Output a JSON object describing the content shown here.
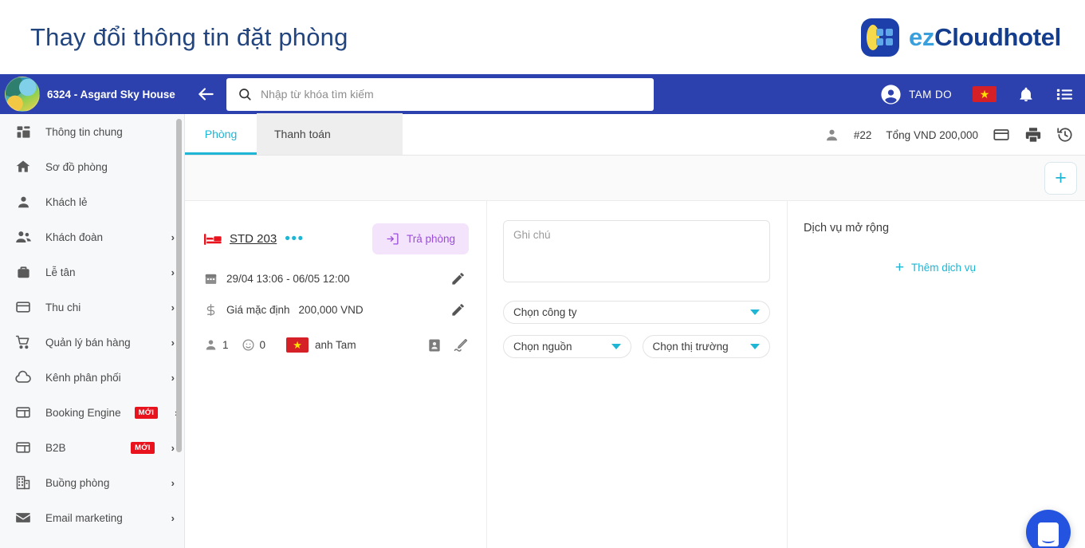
{
  "page": {
    "title": "Thay đổi thông tin đặt phòng"
  },
  "brand": {
    "prefix": "ez",
    "name": "Cloudhotel",
    "icon": "ezcloudhotel-logo-icon",
    "accent_light": "#3aa0dd",
    "accent_dark": "#143d8d"
  },
  "appbar": {
    "hotel": "6324 - Asgard Sky House",
    "hotel_avatar_icon": "hotel-avatar",
    "back_icon": "arrow-left-icon",
    "search": {
      "icon": "search-icon",
      "value": "",
      "placeholder": "Nhập từ khóa tìm kiếm"
    },
    "user": {
      "name": "TAM DO",
      "avatar_icon": "account-circle-icon"
    },
    "language_flag_icon": "vietnam-flag-icon",
    "notification_icon": "bell-icon",
    "menu_icon": "list-menu-icon",
    "background": "#2d41ae"
  },
  "sidebar": {
    "items": [
      {
        "label": "Thông tin chung",
        "icon": "dashboard-icon",
        "chevron": false,
        "badge": ""
      },
      {
        "label": "Sơ đồ phòng",
        "icon": "home-icon",
        "chevron": false,
        "badge": ""
      },
      {
        "label": "Khách lẻ",
        "icon": "person-icon",
        "chevron": false,
        "badge": ""
      },
      {
        "label": "Khách đoàn",
        "icon": "group-icon",
        "chevron": true,
        "badge": ""
      },
      {
        "label": "Lễ tân",
        "icon": "briefcase-icon",
        "chevron": true,
        "badge": ""
      },
      {
        "label": "Thu chi",
        "icon": "credit-card-icon",
        "chevron": true,
        "badge": ""
      },
      {
        "label": "Quản lý bán hàng",
        "icon": "shopping-cart-icon",
        "chevron": true,
        "badge": ""
      },
      {
        "label": "Kênh phân phối",
        "icon": "cloud-icon",
        "chevron": true,
        "badge": ""
      },
      {
        "label": "Booking Engine",
        "icon": "web-layout-icon",
        "chevron": true,
        "badge": "MỚI"
      },
      {
        "label": "B2B",
        "icon": "web-layout-icon",
        "chevron": true,
        "badge": "MỚI"
      },
      {
        "label": "Buồng phòng",
        "icon": "building-icon",
        "chevron": true,
        "badge": ""
      },
      {
        "label": "Email marketing",
        "icon": "envelope-icon",
        "chevron": true,
        "badge": ""
      }
    ],
    "badge_color": "#e8131d"
  },
  "tabs": [
    {
      "label": "Phòng",
      "active": true
    },
    {
      "label": "Thanh toán",
      "active": false
    }
  ],
  "toolbar": {
    "guest_icon": "person-icon",
    "booking_id": "#22",
    "total": "Tổng VND 200,000",
    "card_icon": "credit-card-icon",
    "print_icon": "printer-icon",
    "history_icon": "history-icon",
    "add_icon": "plus-icon",
    "accent": "#1eb6d4"
  },
  "room": {
    "bed_icon": "bed-icon",
    "name": "STD 203",
    "more_icon": "more-dots-icon",
    "checkout_label": "Trả phòng",
    "checkout_icon": "checkout-exit-icon",
    "date_icon": "calendar-icon",
    "dates": "29/04  13:06 - 06/05  12:00",
    "price_icon": "dollar-icon",
    "price_label": "Giá mặc định",
    "price_value": "200,000 VND",
    "adults_icon": "person-icon",
    "adults": "1",
    "children_icon": "child-face-icon",
    "children": "0",
    "guest_flag_icon": "vietnam-flag-icon",
    "guest_name": "anh Tam",
    "id_card_icon": "id-card-icon",
    "signature_icon": "signature-icon",
    "edit_icon": "pencil-icon"
  },
  "form": {
    "note": {
      "value": "",
      "placeholder": "Ghi chú"
    },
    "company": {
      "label": "Chọn công ty",
      "caret_icon": "chevron-down-icon"
    },
    "source": {
      "label": "Chọn nguồn",
      "caret_icon": "chevron-down-icon"
    },
    "market": {
      "label": "Chọn thị trường",
      "caret_icon": "chevron-down-icon"
    }
  },
  "services": {
    "title": "Dịch vụ mở rộng",
    "add_label": "Thêm dịch vụ",
    "add_icon": "plus-icon"
  },
  "chat": {
    "icon": "intercom-chat-icon",
    "color": "#2453e0"
  }
}
